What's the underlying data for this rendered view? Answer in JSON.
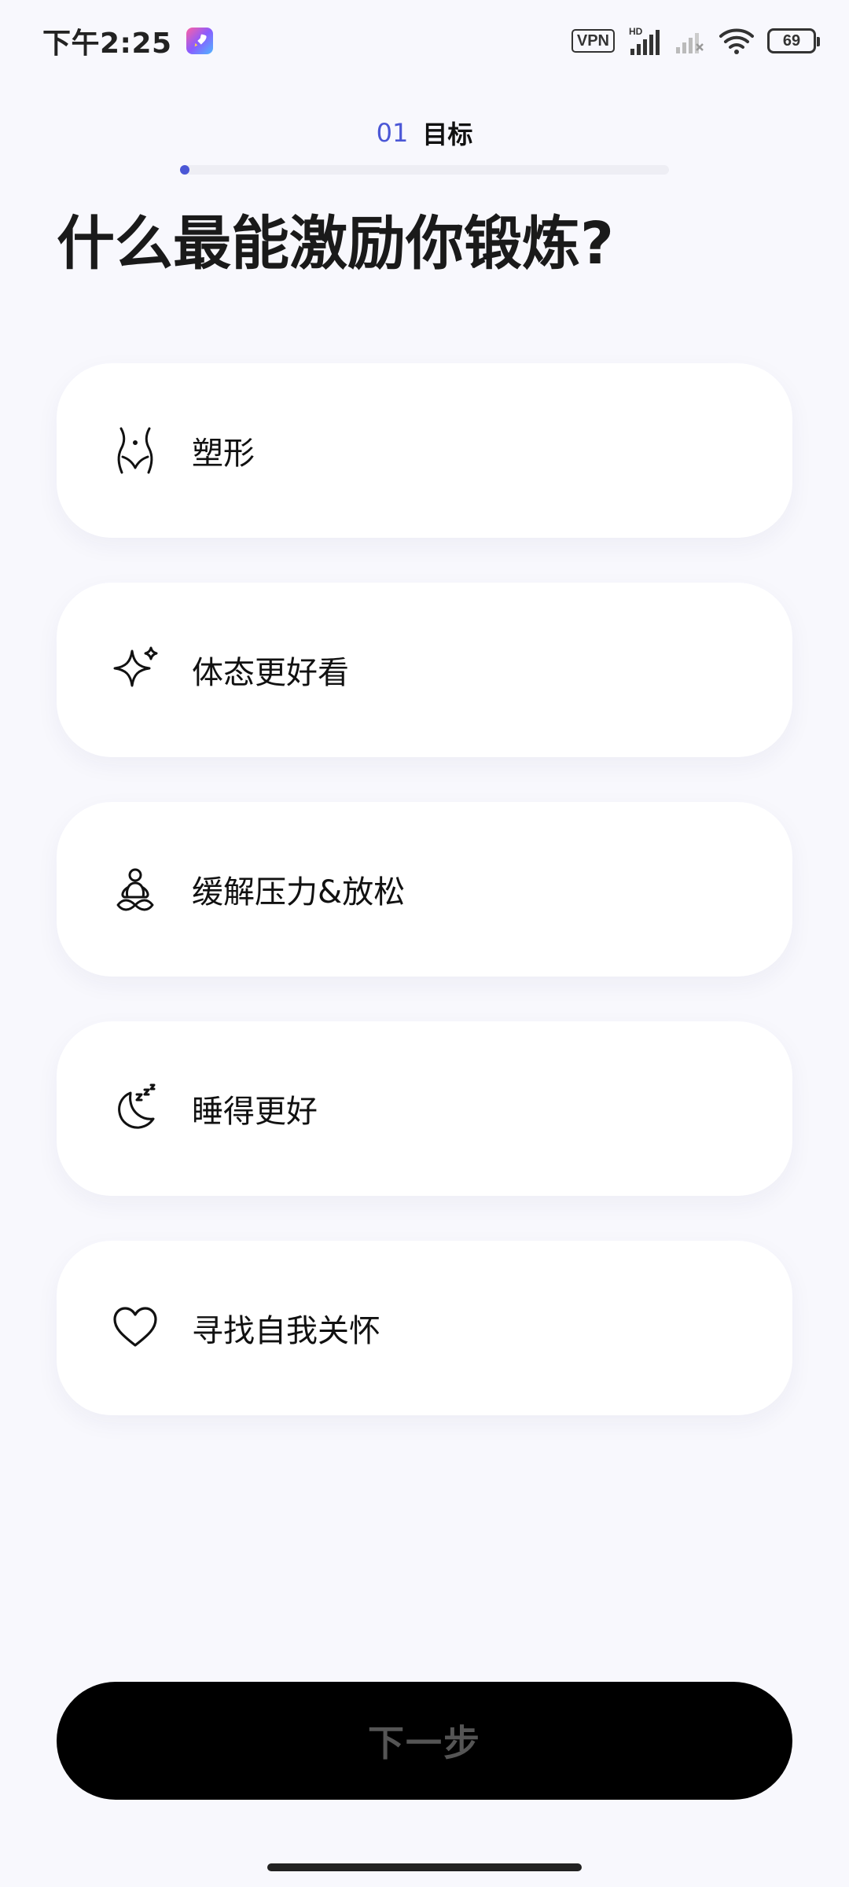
{
  "status_bar": {
    "time": "下午2:25",
    "vpn": "VPN",
    "hd": "HD",
    "battery": "69"
  },
  "progress": {
    "step_number": "01",
    "step_name": "目标",
    "fraction": 0.02,
    "accent_color": "#4b57d6"
  },
  "title": "什么最能激励你锻炼?",
  "options": [
    {
      "label": "塑形",
      "icon": "waist-icon"
    },
    {
      "label": "体态更好看",
      "icon": "sparkle-icon"
    },
    {
      "label": "缓解压力&放松",
      "icon": "meditation-icon"
    },
    {
      "label": "睡得更好",
      "icon": "moon-sleep-icon"
    },
    {
      "label": "寻找自我关怀",
      "icon": "heart-icon"
    }
  ],
  "next_button": {
    "label": "下一步"
  }
}
